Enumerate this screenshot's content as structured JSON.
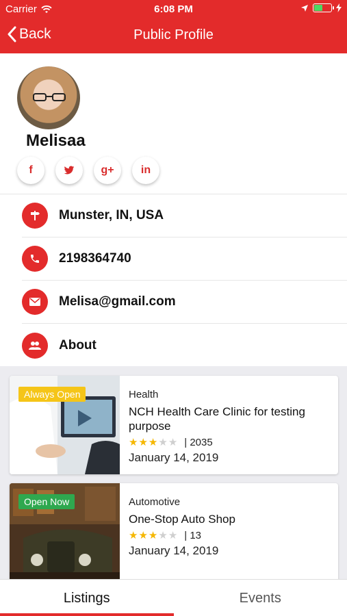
{
  "status_bar": {
    "carrier": "Carrier",
    "time": "6:08 PM"
  },
  "nav": {
    "back_label": "Back",
    "title": "Public Profile"
  },
  "profile": {
    "name": "Melisaa",
    "socials": [
      {
        "icon": "facebook-icon",
        "glyph": "f"
      },
      {
        "icon": "twitter-icon",
        "glyph": "🐦"
      },
      {
        "icon": "google-plus-icon",
        "glyph": "g+"
      },
      {
        "icon": "linkedin-icon",
        "glyph": "in"
      }
    ]
  },
  "info": {
    "location": "Munster, IN, USA",
    "phone": "2198364740",
    "email": "Melisa@gmail.com",
    "about": "About"
  },
  "listings": [
    {
      "badge": "Always Open",
      "badge_color": "#f5c518",
      "category": "Health",
      "title": "NCH Health Care Clinic for testing purpose",
      "rating": 3,
      "rating_max": 5,
      "count": "| 2035",
      "date": "January 14, 2019"
    },
    {
      "badge": "Open Now",
      "badge_color": "#2fa84f",
      "category": "Automotive",
      "title": "One-Stop Auto Shop",
      "rating": 3,
      "rating_max": 5,
      "count": "| 13",
      "date": "January 14, 2019"
    }
  ],
  "tabs": [
    {
      "label": "Listings",
      "active": true
    },
    {
      "label": "Events",
      "active": false
    }
  ],
  "colors": {
    "accent": "#e32b2b",
    "star": "#f5b700"
  }
}
